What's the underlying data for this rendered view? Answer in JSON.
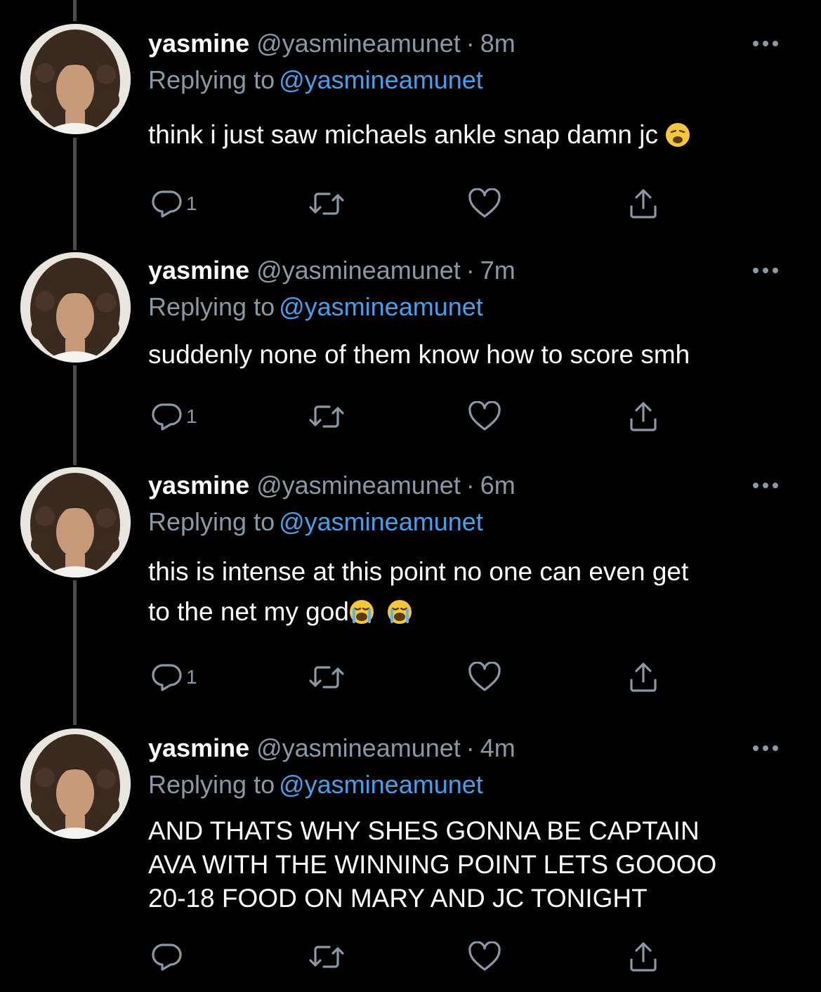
{
  "colors": {
    "background": "#000000",
    "name": "#ffffff",
    "meta": "#8b98a5",
    "link": "#4a9fe8",
    "thread_line": "#4a4a4c"
  },
  "icons": {
    "reply": "reply-icon",
    "retweet": "retweet-icon",
    "like": "heart-icon",
    "share": "share-icon",
    "more": "more-icon"
  },
  "tweets": [
    {
      "display_name": "yasmine",
      "handle": "@yasmineamunet",
      "separator": "·",
      "time": "8m",
      "replying_prefix": "Replying to",
      "replying_to": "@yasmineamunet",
      "text_lines": [
        "think i just saw michaels ankle snap damn jc"
      ],
      "emoji": [
        "weary-face-emoji"
      ],
      "reply_count": "1"
    },
    {
      "display_name": "yasmine",
      "handle": "@yasmineamunet",
      "separator": "·",
      "time": "7m",
      "replying_prefix": "Replying to",
      "replying_to": "@yasmineamunet",
      "text_lines": [
        "suddenly none of them know how to score smh"
      ],
      "emoji": [],
      "reply_count": "1"
    },
    {
      "display_name": "yasmine",
      "handle": "@yasmineamunet",
      "separator": "·",
      "time": "6m",
      "replying_prefix": "Replying to",
      "replying_to": "@yasmineamunet",
      "text_lines": [
        "this is intense at this point no one can even get",
        "to the net my god"
      ],
      "emoji": [
        "loudly-crying-face-emoji",
        "loudly-crying-face-emoji"
      ],
      "reply_count": "1"
    },
    {
      "display_name": "yasmine",
      "handle": "@yasmineamunet",
      "separator": "·",
      "time": "4m",
      "replying_prefix": "Replying to",
      "replying_to": "@yasmineamunet",
      "text_lines": [
        "AND THATS WHY SHES GONNA BE CAPTAIN",
        "AVA WITH THE WINNING POINT LETS GOOOO",
        "20-18 FOOD ON MARY AND JC TONIGHT"
      ],
      "emoji": [],
      "reply_count": ""
    }
  ]
}
